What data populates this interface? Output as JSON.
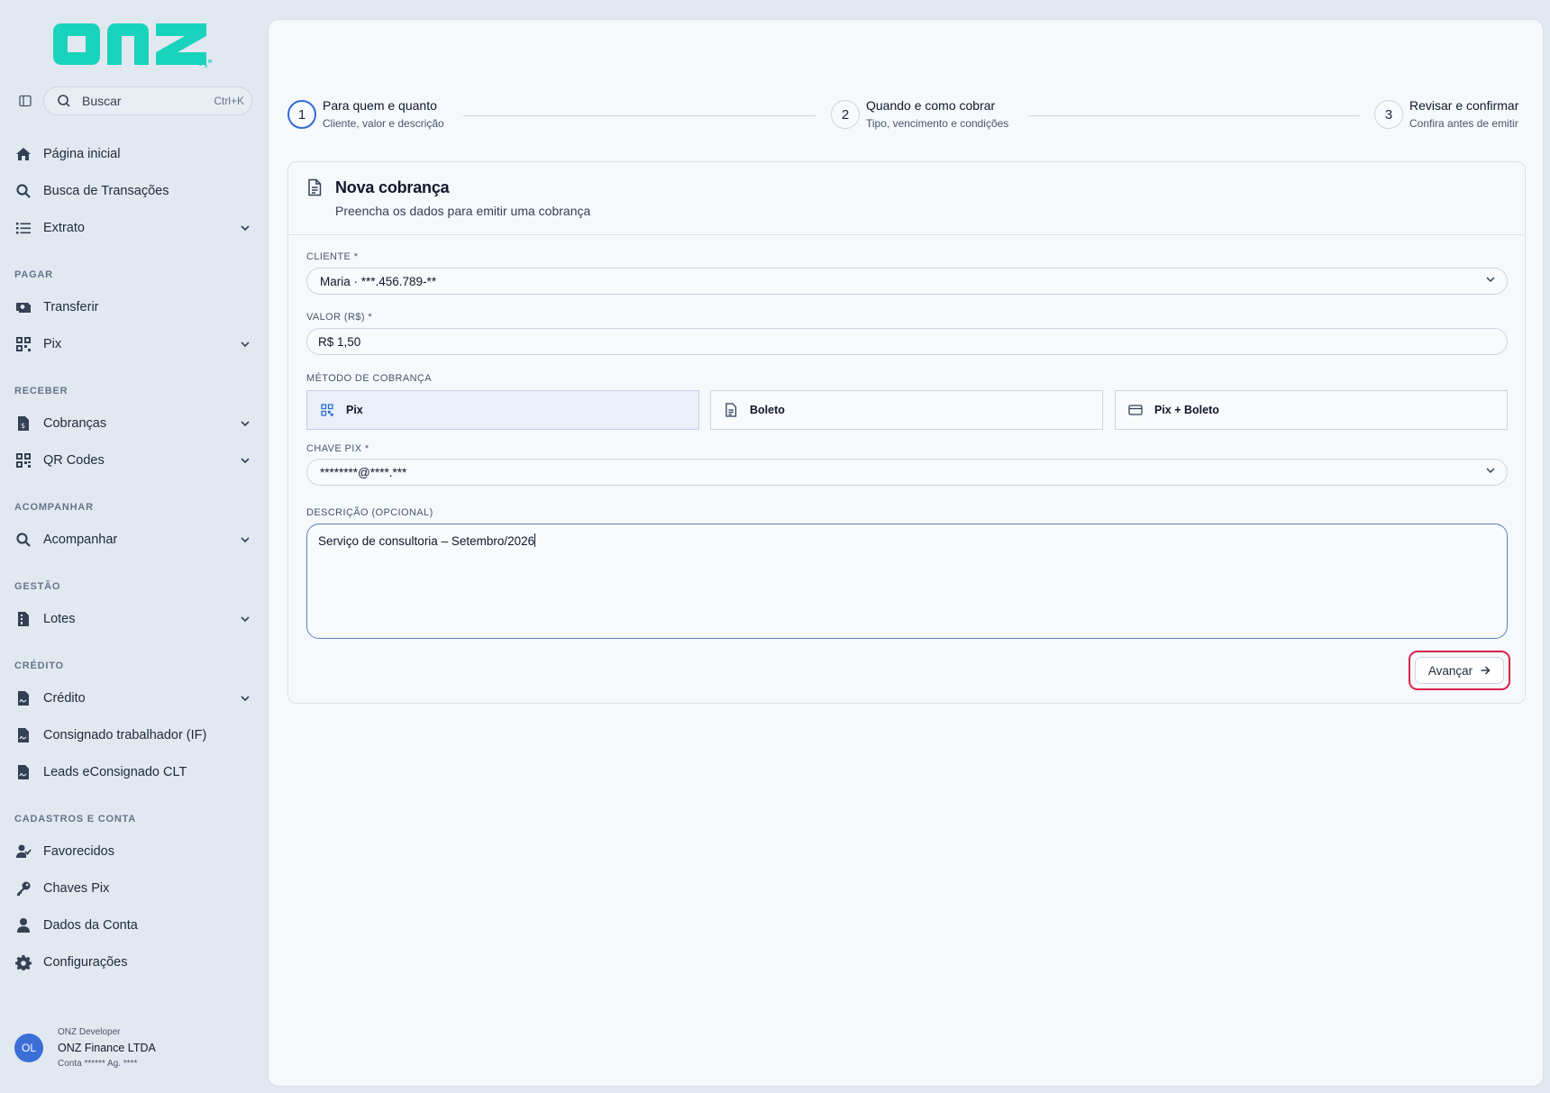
{
  "brand": {
    "logo_text": "onz",
    "accent": "#19d3bd"
  },
  "search": {
    "label": "Buscar",
    "shortcut": "Ctrl+K"
  },
  "nav": {
    "home": "Página inicial",
    "tx_search": "Busca de Transações",
    "statement": "Extrato",
    "sec_pay": "PAGAR",
    "transfer": "Transferir",
    "pix": "Pix",
    "sec_receive": "RECEBER",
    "charges": "Cobranças",
    "qrcodes": "QR Codes",
    "sec_track": "ACOMPANHAR",
    "track": "Acompanhar",
    "sec_mgmt": "GESTÃO",
    "batches": "Lotes",
    "sec_credit": "CRÉDITO",
    "credit": "Crédito",
    "payroll": "Consignado trabalhador (IF)",
    "leads": "Leads eConsignado CLT",
    "sec_reg": "CADASTROS E CONTA",
    "favorites": "Favorecidos",
    "pix_keys": "Chaves Pix",
    "account_data": "Dados da Conta",
    "settings": "Configurações"
  },
  "account": {
    "initials": "OL",
    "role": "ONZ Developer",
    "company": "ONZ Finance LTDA",
    "number": "Conta ****** Ag. ****"
  },
  "stepper": [
    {
      "num": "1",
      "title": "Para quem e quanto",
      "subtitle": "Cliente, valor e descrição"
    },
    {
      "num": "2",
      "title": "Quando e como cobrar",
      "subtitle": "Tipo, vencimento e condições"
    },
    {
      "num": "3",
      "title": "Revisar e confirmar",
      "subtitle": "Confira antes de emitir"
    }
  ],
  "form": {
    "title": "Nova cobrança",
    "subtitle": "Preencha os dados para emitir uma cobrança",
    "client_label": "CLIENTE  *",
    "client_value": "Maria · ***.456.789-**",
    "amount_label": "VALOR (R$)  *",
    "amount_value": "R$ 1,50",
    "method_label": "MÉTODO DE COBRANÇA",
    "methods": [
      "Pix",
      "Boleto",
      "Pix + Boleto"
    ],
    "selected_method": "Pix",
    "pix_key_label": "CHAVE PIX  *",
    "pix_key_value": "********@****.***",
    "desc_label": "DESCRIÇÃO (OPCIONAL)",
    "desc_value": "Serviço de consultoria – Setembro/2026",
    "next_button": "Avançar"
  }
}
